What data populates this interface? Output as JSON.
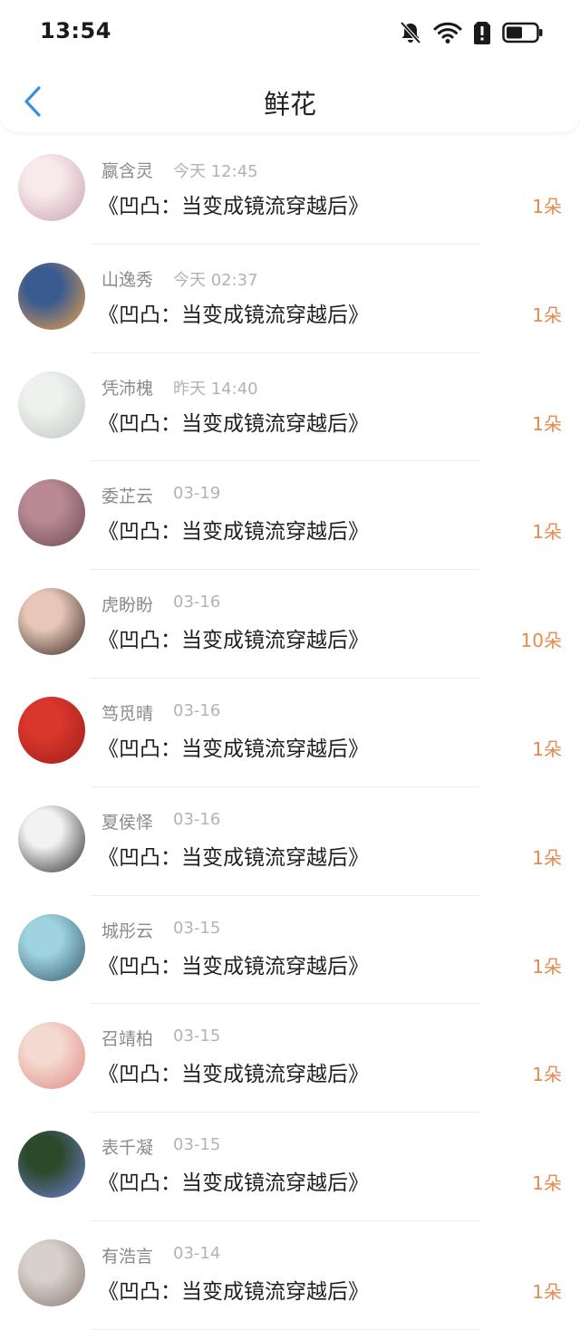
{
  "status": {
    "time": "13:54"
  },
  "nav": {
    "title": "鲜花"
  },
  "records": [
    {
      "name": "嬴含灵",
      "date": "今天 12:45",
      "book": "《凹凸：当变成镜流穿越后》",
      "amount": "1朵",
      "avatar": [
        "#f7e9ec",
        "#c9a3ad"
      ]
    },
    {
      "name": "山逸秀",
      "date": "今天 02:37",
      "book": "《凹凸：当变成镜流穿越后》",
      "amount": "1朵",
      "avatar": [
        "#3a5b8f",
        "#f0a24a"
      ]
    },
    {
      "name": "凭沛槐",
      "date": "昨天 14:40",
      "book": "《凹凸：当变成镜流穿越后》",
      "amount": "1朵",
      "avatar": [
        "#eef1ee",
        "#bfc7c2"
      ]
    },
    {
      "name": "委芷云",
      "date": "03-19",
      "book": "《凹凸：当变成镜流穿越后》",
      "amount": "1朵",
      "avatar": [
        "#b98a94",
        "#6d4a55"
      ]
    },
    {
      "name": "虎盼盼",
      "date": "03-16",
      "book": "《凹凸：当变成镜流穿越后》",
      "amount": "10朵",
      "avatar": [
        "#e8c7b8",
        "#3a2a26"
      ]
    },
    {
      "name": "笃觅晴",
      "date": "03-16",
      "book": "《凹凸：当变成镜流穿越后》",
      "amount": "1朵",
      "avatar": [
        "#d9362c",
        "#9e1f18"
      ]
    },
    {
      "name": "夏侯怿",
      "date": "03-16",
      "book": "《凹凸：当变成镜流穿越后》",
      "amount": "1朵",
      "avatar": [
        "#f2f2f2",
        "#2b2b2b"
      ]
    },
    {
      "name": "城彤云",
      "date": "03-15",
      "book": "《凹凸：当变成镜流穿越后》",
      "amount": "1朵",
      "avatar": [
        "#9fd3e0",
        "#345a6a"
      ]
    },
    {
      "name": "召靖柏",
      "date": "03-15",
      "book": "《凹凸：当变成镜流穿越后》",
      "amount": "1朵",
      "avatar": [
        "#f4d9d0",
        "#e08a83"
      ]
    },
    {
      "name": "表千凝",
      "date": "03-15",
      "book": "《凹凸：当变成镜流穿越后》",
      "amount": "1朵",
      "avatar": [
        "#2c4a2a",
        "#6f7fd6"
      ]
    },
    {
      "name": "有浩言",
      "date": "03-14",
      "book": "《凹凸：当变成镜流穿越后》",
      "amount": "1朵",
      "avatar": [
        "#d8d0cc",
        "#8a7a74"
      ]
    }
  ]
}
